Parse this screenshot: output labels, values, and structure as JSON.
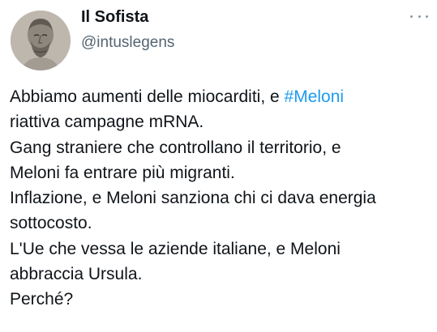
{
  "author": {
    "display_name": "Il Sofista",
    "handle": "@intuslegens",
    "avatar_icon": "philosopher-bust-avatar"
  },
  "more_icon": "more-horizontal-icon",
  "colors": {
    "text": "#0f1419",
    "secondary": "#536471",
    "link": "#1d9bf0"
  },
  "tweet": {
    "line1_before": "Abbiamo aumenti delle miocarditi, e ",
    "line1_hashtag": "#Meloni",
    "lines": [
      "riattiva campagne mRNA.",
      "Gang straniere che controllano il territorio, e",
      "Meloni fa entrare più migranti.",
      "Inflazione, e Meloni sanziona chi ci dava energia",
      "sottocosto.",
      "L'Ue che vessa le aziende italiane, e Meloni",
      "abbraccia Ursula.",
      "Perché?"
    ]
  }
}
